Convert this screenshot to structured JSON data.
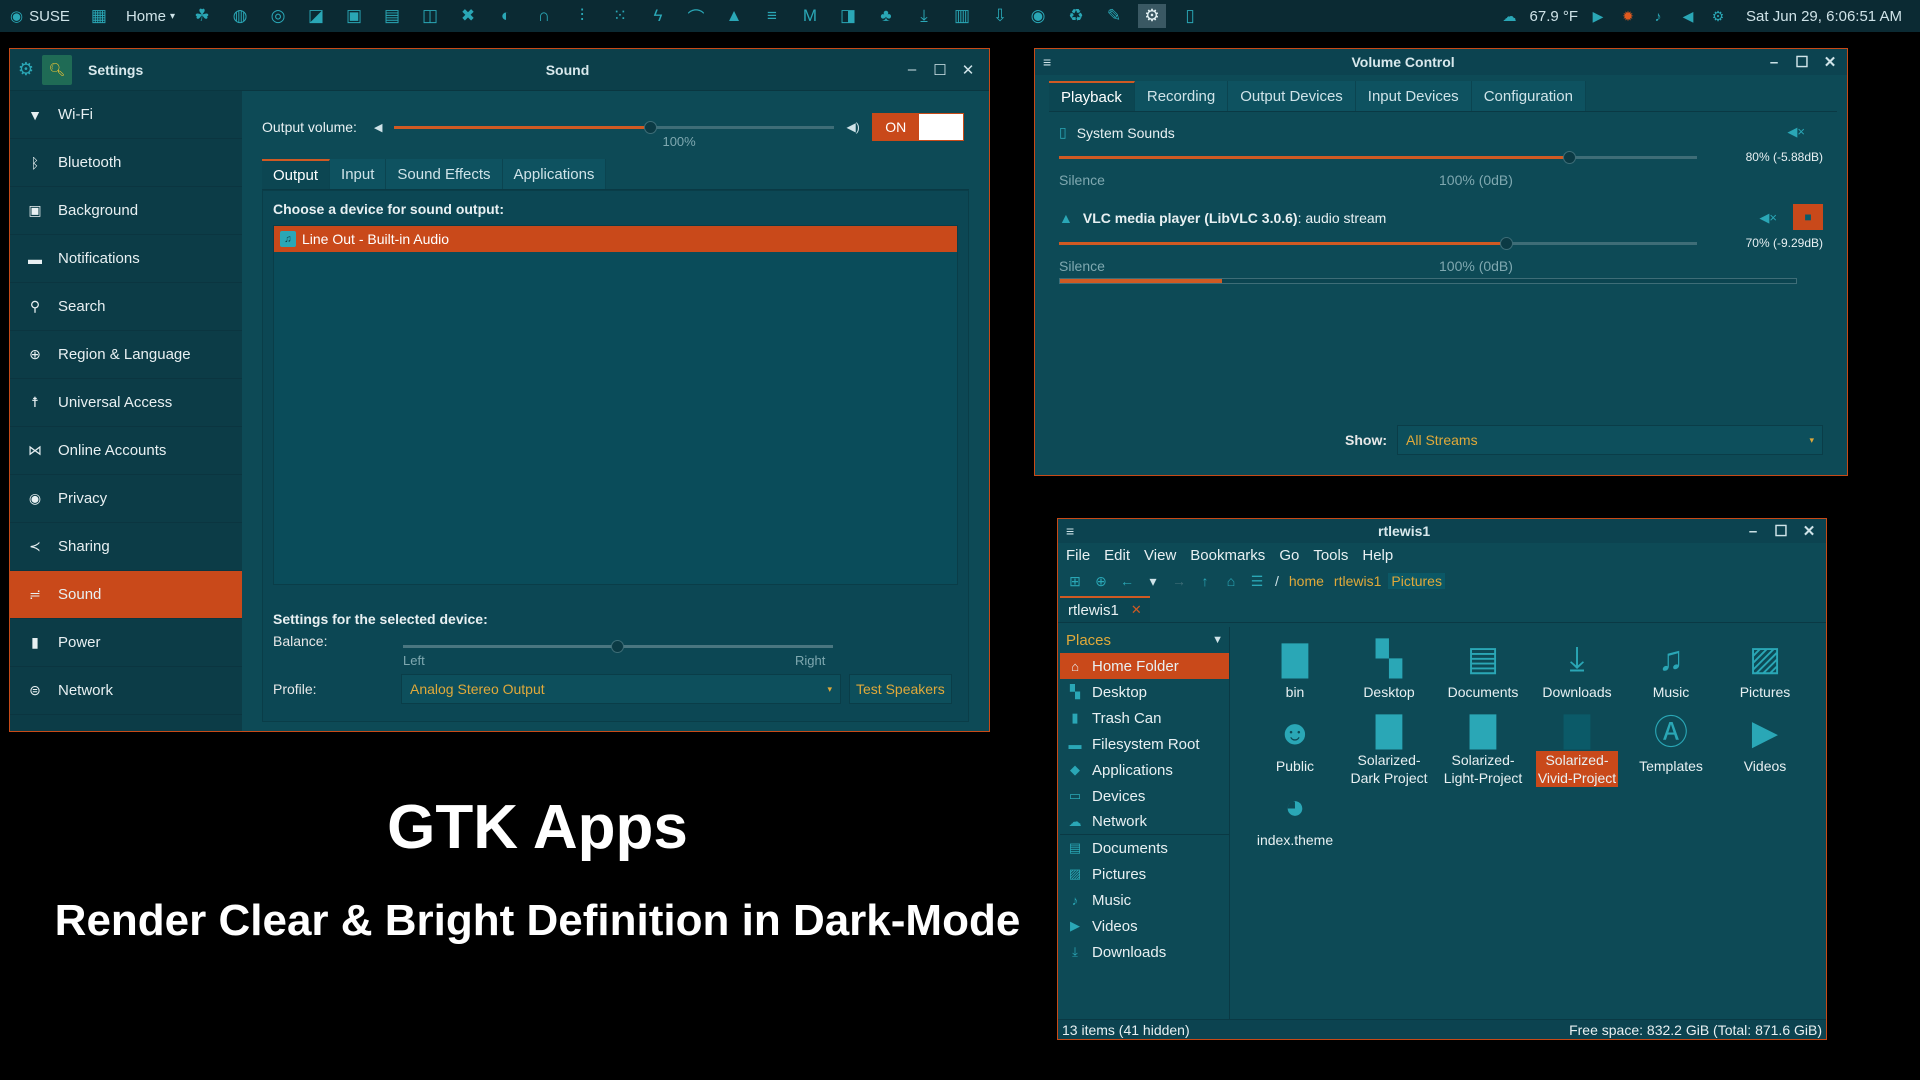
{
  "panel": {
    "distro": "SUSE",
    "home": "Home",
    "weather": "67.9 °F",
    "datetime": "Sat Jun 29,  6:06:51 AM",
    "launchers": [
      "app-grid",
      "gecko",
      "firefox",
      "chrome",
      "screenshot",
      "terminal",
      "files",
      "camera",
      "xing",
      "podcast",
      "headphones",
      "mixer",
      "dots",
      "thunderbolt",
      "paint",
      "inkscape",
      "list",
      "gmail",
      "outlook",
      "recycle-tree",
      "download",
      "calculator",
      "arrow-down-box",
      "eye",
      "recycle",
      "brush",
      "settings",
      "speaker"
    ]
  },
  "settings": {
    "title": "Settings",
    "page_title": "Sound",
    "sidebar": [
      {
        "label": "Wi-Fi",
        "icon": "wifi-icon"
      },
      {
        "label": "Bluetooth",
        "icon": "bluetooth-icon"
      },
      {
        "label": "Background",
        "icon": "background-icon"
      },
      {
        "label": "Notifications",
        "icon": "notifications-icon"
      },
      {
        "label": "Search",
        "icon": "search-icon"
      },
      {
        "label": "Region & Language",
        "icon": "globe-icon"
      },
      {
        "label": "Universal Access",
        "icon": "accessibility-icon"
      },
      {
        "label": "Online Accounts",
        "icon": "accounts-icon"
      },
      {
        "label": "Privacy",
        "icon": "eye-icon"
      },
      {
        "label": "Sharing",
        "icon": "share-icon"
      },
      {
        "label": "Sound",
        "icon": "sound-icon"
      },
      {
        "label": "Power",
        "icon": "battery-icon"
      },
      {
        "label": "Network",
        "icon": "network-icon"
      }
    ],
    "selected": "Sound",
    "output_volume_label": "Output volume:",
    "volume_level": 0.58,
    "volume_mark": "100%",
    "switch_label": "ON",
    "tabs": [
      "Output",
      "Input",
      "Sound Effects",
      "Applications"
    ],
    "choose_label": "Choose a device for sound output:",
    "device": "Line Out - Built-in Audio",
    "selected_settings_label": "Settings for the selected device:",
    "balance_label": "Balance:",
    "balance_left": "Left",
    "balance_right": "Right",
    "profile_label": "Profile:",
    "profile_value": "Analog Stereo Output",
    "test_button": "Test Speakers"
  },
  "caption": {
    "line1": "GTK Apps",
    "line2": "Render Clear & Bright Definition in Dark-Mode"
  },
  "volume_control": {
    "title": "Volume Control",
    "tabs": [
      "Playback",
      "Recording",
      "Output Devices",
      "Input Devices",
      "Configuration"
    ],
    "streams": [
      {
        "name": "System Sounds",
        "bold_part": "",
        "level": 0.8,
        "percent": "80% (-5.88dB)",
        "silence": "Silence",
        "mark": "100% (0dB)"
      },
      {
        "name": ": audio stream",
        "bold_part": "VLC media player (LibVLC 3.0.6)",
        "level": 0.7,
        "percent": "70% (-9.29dB)",
        "silence": "Silence",
        "mark": "100% (0dB)",
        "meter": 0.22
      }
    ],
    "show_label": "Show:",
    "show_value": "All Streams"
  },
  "files": {
    "title": "rtlewis1",
    "menu": [
      "File",
      "Edit",
      "View",
      "Bookmarks",
      "Go",
      "Tools",
      "Help"
    ],
    "path": [
      "/",
      "home",
      "rtlewis1",
      "Pictures"
    ],
    "tab_label": "rtlewis1",
    "places_header": "Places",
    "places": [
      {
        "label": "Home Folder",
        "icon": "home-folder-icon"
      },
      {
        "label": "Desktop",
        "icon": "desktop-icon"
      },
      {
        "label": "Trash Can",
        "icon": "trash-icon"
      },
      {
        "label": "Filesystem Root",
        "icon": "folder-icon"
      },
      {
        "label": "Applications",
        "icon": "applications-icon"
      },
      {
        "label": "Devices",
        "icon": "devices-icon"
      },
      {
        "label": "Network",
        "icon": "network-cloud-icon"
      },
      {
        "label": "Documents",
        "icon": "documents-folder-icon"
      },
      {
        "label": "Pictures",
        "icon": "pictures-folder-icon"
      },
      {
        "label": "Music",
        "icon": "music-folder-icon"
      },
      {
        "label": "Videos",
        "icon": "videos-folder-icon"
      },
      {
        "label": "Downloads",
        "icon": "downloads-folder-icon"
      }
    ],
    "items": [
      {
        "label": "bin",
        "icon": "folder-icon"
      },
      {
        "label": "Desktop",
        "icon": "desktop-folder-icon"
      },
      {
        "label": "Documents",
        "icon": "documents-folder-icon"
      },
      {
        "label": "Downloads",
        "icon": "downloads-folder-icon"
      },
      {
        "label": "Music",
        "icon": "music-folder-icon"
      },
      {
        "label": "Pictures",
        "icon": "pictures-folder-icon"
      },
      {
        "label": "Public",
        "icon": "public-folder-icon"
      },
      {
        "label": "Solarized-Dark Project",
        "icon": "folder-icon"
      },
      {
        "label": "Solarized-Light-Project",
        "icon": "folder-icon"
      },
      {
        "label": "Solarized-Vivid-Project",
        "icon": "folder-icon"
      },
      {
        "label": "Templates",
        "icon": "templates-folder-icon"
      },
      {
        "label": "Videos",
        "icon": "videos-folder-icon"
      },
      {
        "label": "index.theme",
        "icon": "theme-file-icon"
      }
    ],
    "items_display": [
      "bin",
      "Desktop",
      "Documents",
      "Downloads",
      "Music",
      "Pictures",
      "Public",
      "Solarized-\nDark Project",
      "Solarized-\nLight-Project",
      "Solarized-\nVivid-Project",
      "Templates",
      "Videos",
      "index.theme"
    ],
    "selected_item": "Solarized-Vivid-Project",
    "status_left": "13 items (41 hidden)",
    "status_right": "Free space: 832.2 GiB (Total: 871.6 GiB)"
  },
  "colors": {
    "accent": "#c9491a",
    "window_bg": "#0d4a56",
    "icon": "#2aa7b6",
    "link_text": "#e0a93a"
  }
}
